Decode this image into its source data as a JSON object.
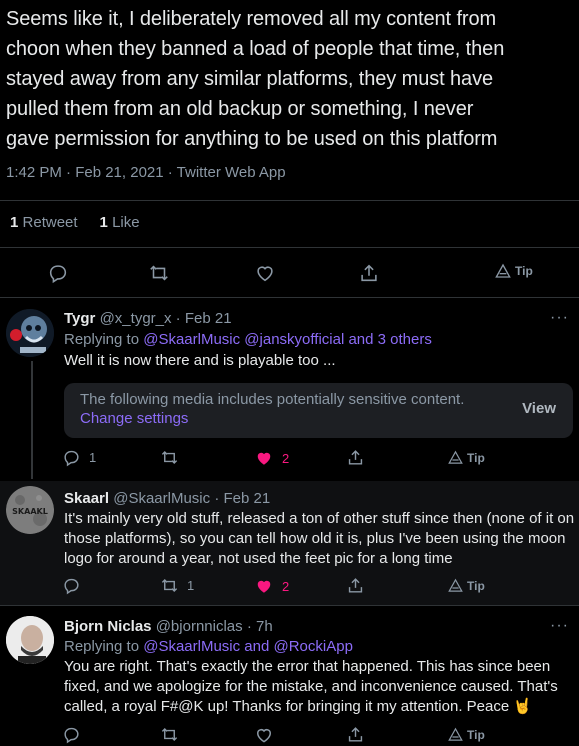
{
  "main_tweet": {
    "text_lines": [
      "Seems like it, I deliberately removed all my content from",
      "choon when they banned a load of people that time, then",
      "stayed away from any similar platforms, they must have",
      "pulled them from an old backup or something, I never",
      "gave permission for anything to be used on this platform"
    ],
    "time": "1:42 PM · Feb 21, 2021 · Twitter Web App",
    "retweet_count": "1",
    "retweet_label": "Retweet",
    "like_count": "1",
    "like_label": "Like",
    "tip_label": "Tip"
  },
  "replies": [
    {
      "name": "Tygr",
      "handle": "@x_tygr_x",
      "date": "· Feb 21",
      "replying_prefix": "Replying to",
      "replying_mentions": "@SkaarlMusic @janskyofficial and 3 others",
      "text": "Well it is now there and is playable too  ...",
      "sensitive_message": "The following media includes potentially sensitive content.",
      "change_settings": "Change settings",
      "view_label": "View",
      "reply_count": "1",
      "retweet_count": "",
      "like_count": "2",
      "tip_label": "Tip",
      "liked": true
    },
    {
      "name": "Skaarl",
      "handle": "@SkaarlMusic",
      "date": "· Feb 21",
      "avatar_text": "SKAAKL",
      "text": "It's mainly very old stuff, released a ton of other stuff since then (none of it on those platforms), so you can tell how old it is, plus I've been using the moon logo for around a year, not used the feet pic for a long time",
      "reply_count": "",
      "retweet_count": "1",
      "like_count": "2",
      "tip_label": "Tip",
      "liked": true
    },
    {
      "name": "Bjorn Niclas",
      "handle": "@bjornniclas",
      "date": "· 7h",
      "replying_prefix": "Replying to",
      "replying_mentions": "@SkaarlMusic and @RockiApp",
      "text": "You are right. That's exactly the error that happened. This has since been fixed, and we apologize for the mistake, and inconvenience caused. That's called, a royal F#@K up! Thanks for bringing it my attention. Peace 🤘",
      "tip_label": "Tip"
    }
  ],
  "more_label": "···",
  "colors": {
    "background": "#000000",
    "text": "#e7e9ea",
    "muted": "#8b98a5",
    "mention": "#8c6cf7",
    "like": "#f91880"
  }
}
